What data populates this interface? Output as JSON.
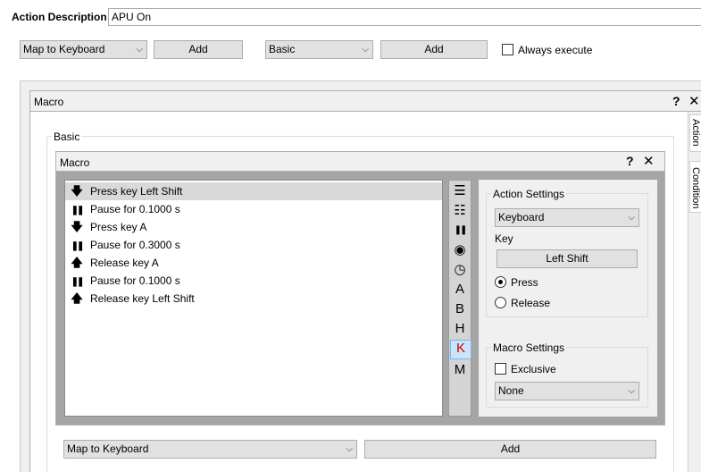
{
  "top": {
    "action_description_label": "Action Description",
    "action_description_value": "APU On",
    "map_select": "Map to Keyboard",
    "add1": "Add",
    "basic_select": "Basic",
    "add2": "Add",
    "always_execute": "Always execute"
  },
  "outer_macro": {
    "title": "Macro",
    "help": "?",
    "close": "✕"
  },
  "basic_group": {
    "title": "Basic"
  },
  "inner_macro": {
    "title": "Macro",
    "help": "?",
    "close": "✕"
  },
  "macro_list": [
    {
      "icon": "arrow-down",
      "glyph": "🡇",
      "text": "Press key Left Shift",
      "selected": true
    },
    {
      "icon": "pause",
      "glyph": "❚❚",
      "text": "Pause for 0.1000 s",
      "selected": false
    },
    {
      "icon": "arrow-down",
      "glyph": "🡇",
      "text": "Press key A",
      "selected": false
    },
    {
      "icon": "pause",
      "glyph": "❚❚",
      "text": "Pause for 0.3000 s",
      "selected": false
    },
    {
      "icon": "arrow-up",
      "glyph": "🡅",
      "text": "Release key A",
      "selected": false
    },
    {
      "icon": "pause",
      "glyph": "❚❚",
      "text": "Pause for 0.1000 s",
      "selected": false
    },
    {
      "icon": "arrow-up",
      "glyph": "🡅",
      "text": "Release key Left Shift",
      "selected": false
    }
  ],
  "toolbar": [
    {
      "name": "list-icon",
      "glyph": "☰"
    },
    {
      "name": "list-clear-icon",
      "glyph": "☷"
    },
    {
      "name": "pause-icon",
      "glyph": "❚❚"
    },
    {
      "name": "record-icon",
      "glyph": "◉"
    },
    {
      "name": "timer-icon",
      "glyph": "◷"
    },
    {
      "name": "a-icon",
      "glyph": "A"
    },
    {
      "name": "b-icon",
      "glyph": "B"
    },
    {
      "name": "h-icon",
      "glyph": "H"
    },
    {
      "name": "k-icon",
      "glyph": "K",
      "active": true
    },
    {
      "name": "m-icon",
      "glyph": "M"
    }
  ],
  "action_settings": {
    "title": "Action Settings",
    "device": "Keyboard",
    "key_label": "Key",
    "key_value": "Left Shift",
    "press": "Press",
    "release": "Release"
  },
  "macro_settings": {
    "title": "Macro Settings",
    "exclusive": "Exclusive",
    "mode": "None"
  },
  "side_tabs": {
    "action": "Action",
    "condition": "Condition"
  },
  "bottom": {
    "map_select": "Map to Keyboard",
    "add": "Add"
  },
  "colors": {
    "k_active": "#c00000",
    "panel_bg": "#a5a5a5"
  }
}
